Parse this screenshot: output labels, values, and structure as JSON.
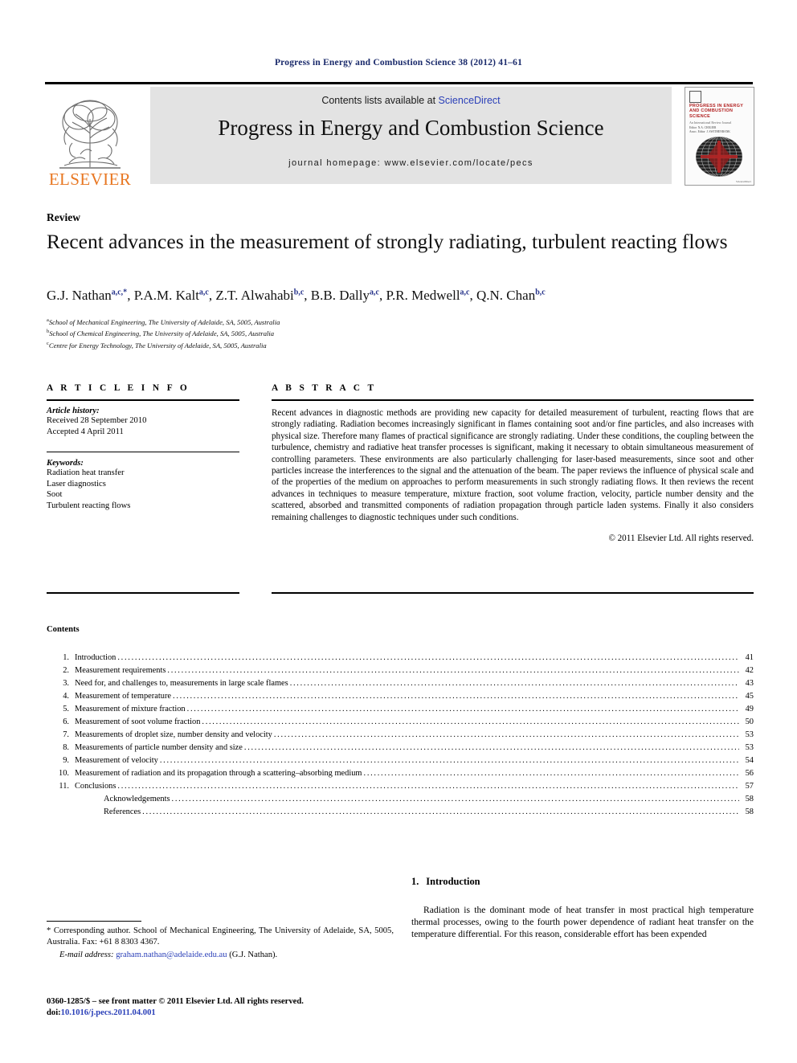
{
  "running_head": "Progress in Energy and Combustion Science 38 (2012) 41–61",
  "masthead": {
    "contents_prefix": "Contents lists available at ",
    "sciencedirect": "ScienceDirect",
    "journal_title": "Progress in Energy and Combustion Science",
    "homepage": "journal homepage: www.elsevier.com/locate/pecs",
    "publisher_logo_label": "ELSEVIER",
    "cover": {
      "title": "PROGRESS IN ENERGY AND COMBUSTION SCIENCE",
      "subtitle": "An International Review Journal",
      "editors": "Editor    N.A. CHIGIER\nAssociate Editor    J. SWITHENBANK",
      "footer": "ScienceDirect"
    },
    "accent_color": "#2a3fb8",
    "logo_color": "#E87722",
    "banner_color": "#e3e3e3"
  },
  "article": {
    "kind": "Review",
    "title": "Recent advances in the measurement of strongly radiating, turbulent reacting flows",
    "authors": [
      {
        "name": "G.J. Nathan",
        "sup": "a,c,*"
      },
      {
        "name": "P.A.M. Kalt",
        "sup": "a,c"
      },
      {
        "name": "Z.T. Alwahabi",
        "sup": "b,c"
      },
      {
        "name": "B.B. Dally",
        "sup": "a,c"
      },
      {
        "name": "P.R. Medwell",
        "sup": "a,c"
      },
      {
        "name": "Q.N. Chan",
        "sup": "b,c"
      }
    ],
    "affiliations": [
      {
        "mark": "a",
        "text": "School of Mechanical Engineering, The University of Adelaide, SA, 5005, Australia"
      },
      {
        "mark": "b",
        "text": "School of Chemical Engineering, The University of Adelaide, SA, 5005, Australia"
      },
      {
        "mark": "c",
        "text": "Centre for Energy Technology, The University of Adelaide, SA, 5005, Australia"
      }
    ]
  },
  "article_info": {
    "heading": "A R T I C L E   I N F O",
    "history_title": "Article history:",
    "history_lines": [
      "Received 28 September 2010",
      "Accepted 4 April 2011"
    ],
    "keywords_title": "Keywords:",
    "keywords": [
      "Radiation heat transfer",
      "Laser diagnostics",
      "Soot",
      "Turbulent reacting flows"
    ]
  },
  "abstract": {
    "heading": "A B S T R A C T",
    "body": "Recent advances in diagnostic methods are providing new capacity for detailed measurement of turbulent, reacting flows that are strongly radiating. Radiation becomes increasingly significant in flames containing soot and/or fine particles, and also increases with physical size. Therefore many flames of practical significance are strongly radiating. Under these conditions, the coupling between the turbulence, chemistry and radiative heat transfer processes is significant, making it necessary to obtain simultaneous measurement of controlling parameters. These environments are also particularly challenging for laser-based measurements, since soot and other particles increase the interferences to the signal and the attenuation of the beam. The paper reviews the influence of physical scale and of the properties of the medium on approaches to perform measurements in such strongly radiating flows. It then reviews the recent advances in techniques to measure temperature, mixture fraction, soot volume fraction, velocity, particle number density and the scattered, absorbed and transmitted components of radiation propagation through particle laden systems. Finally it also considers remaining challenges to diagnostic techniques under such conditions.",
    "copyright": "© 2011 Elsevier Ltd. All rights reserved."
  },
  "contents": {
    "heading": "Contents",
    "entries": [
      {
        "num": "1.",
        "label": "Introduction",
        "page": "41",
        "sub": false
      },
      {
        "num": "2.",
        "label": "Measurement requirements",
        "page": "42",
        "sub": false
      },
      {
        "num": "3.",
        "label": "Need for, and challenges to, measurements in large scale flames",
        "page": "43",
        "sub": false
      },
      {
        "num": "4.",
        "label": "Measurement of temperature",
        "page": "45",
        "sub": false
      },
      {
        "num": "5.",
        "label": "Measurement of mixture fraction",
        "page": "49",
        "sub": false
      },
      {
        "num": "6.",
        "label": "Measurement of soot volume fraction",
        "page": "50",
        "sub": false
      },
      {
        "num": "7.",
        "label": "Measurements of droplet size, number density and velocity",
        "page": "53",
        "sub": false
      },
      {
        "num": "8.",
        "label": "Measurements of particle number density and size",
        "page": "53",
        "sub": false
      },
      {
        "num": "9.",
        "label": "Measurement of velocity",
        "page": "54",
        "sub": false
      },
      {
        "num": "10.",
        "label": "Measurement of radiation and its propagation through a scattering–absorbing medium",
        "page": "56",
        "sub": false
      },
      {
        "num": "11.",
        "label": "Conclusions",
        "page": "57",
        "sub": false
      },
      {
        "num": "",
        "label": "Acknowledgements",
        "page": "58",
        "sub": true
      },
      {
        "num": "",
        "label": "References",
        "page": "58",
        "sub": true
      }
    ]
  },
  "introduction": {
    "number": "1.",
    "heading": "Introduction",
    "paragraph": "Radiation is the dominant mode of heat transfer in most practical high temperature thermal processes, owing to the fourth power dependence of radiant heat transfer on the temperature differential. For this reason, considerable effort has been expended"
  },
  "footnotes": {
    "corresponding": "* Corresponding author. School of Mechanical Engineering, The University of Adelaide, SA, 5005, Australia. Fax: +61 8 8303 4367.",
    "email_label": "E-mail address:",
    "email": "graham.nathan@adelaide.edu.au",
    "email_owner": "(G.J. Nathan).",
    "issn_line": "0360-1285/$ – see front matter © 2011 Elsevier Ltd. All rights reserved.",
    "doi_label": "doi:",
    "doi": "10.1016/j.pecs.2011.04.001"
  }
}
